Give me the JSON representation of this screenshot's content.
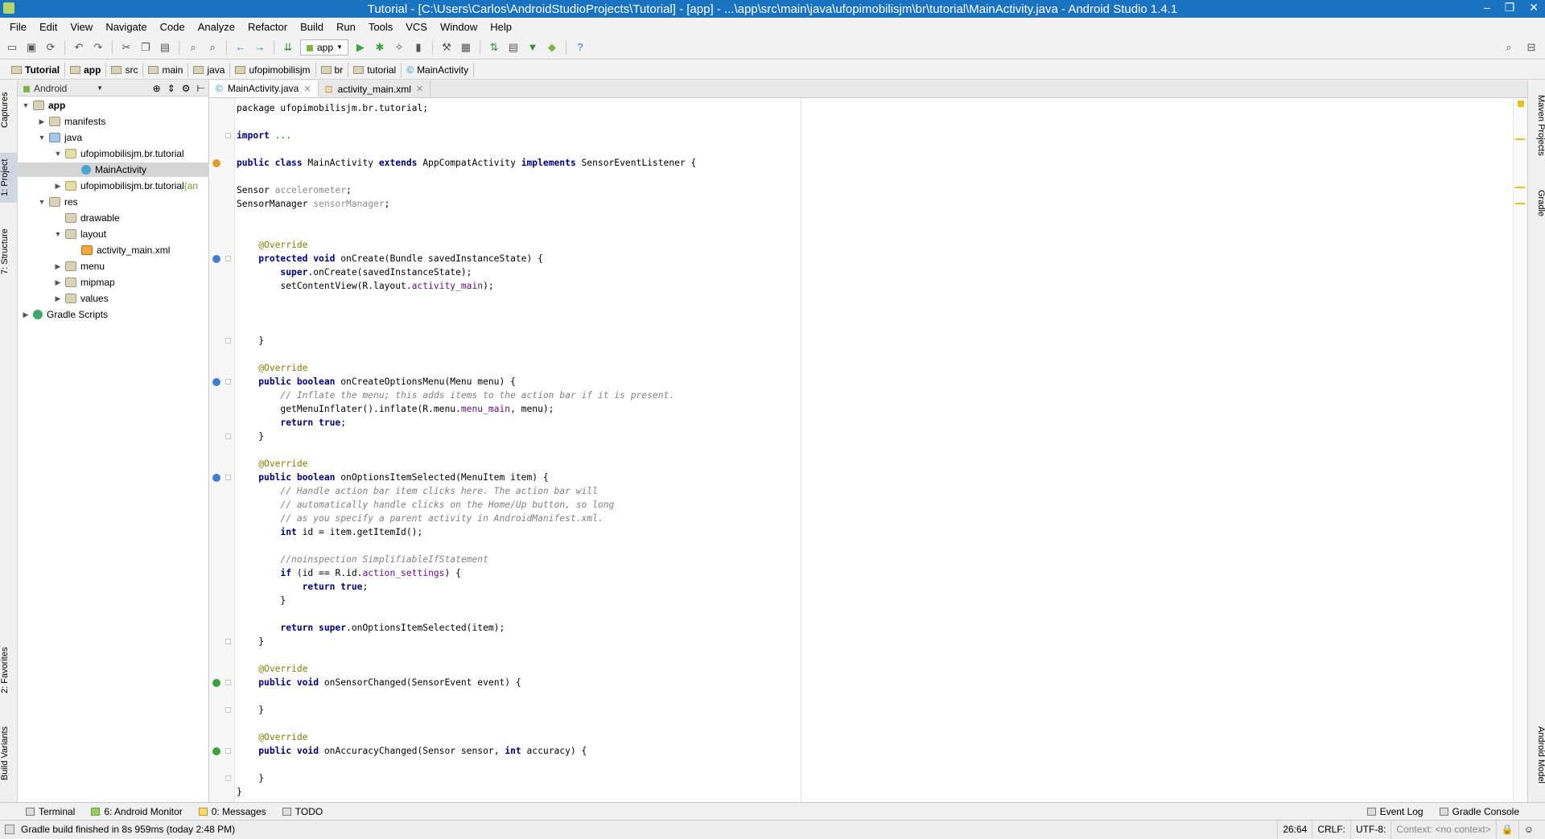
{
  "window": {
    "title": "Tutorial - [C:\\Users\\Carlos\\AndroidStudioProjects\\Tutorial] - [app] - ...\\app\\src\\main\\java\\ufopimobilisjm\\br\\tutorial\\MainActivity.java - Android Studio 1.4.1",
    "minimize": "–",
    "restore": "❐",
    "close": "✕"
  },
  "menu": [
    "File",
    "Edit",
    "View",
    "Navigate",
    "Code",
    "Analyze",
    "Refactor",
    "Build",
    "Run",
    "Tools",
    "VCS",
    "Window",
    "Help"
  ],
  "toolbar": {
    "run_config": "app"
  },
  "breadcrumb": [
    "Tutorial",
    "app",
    "src",
    "main",
    "java",
    "ufopimobilisjm",
    "br",
    "tutorial",
    "MainActivity"
  ],
  "left_tabs": [
    "Captures",
    "1: Project",
    "7: Structure",
    "2: Favorites",
    "Build Variants"
  ],
  "right_tabs": [
    "Maven Projects",
    "Gradle",
    "Android Model"
  ],
  "project": {
    "view_mode": "Android",
    "tree": [
      {
        "label": "app",
        "level": 0,
        "icon": "app",
        "expanded": true,
        "bold": true
      },
      {
        "label": "manifests",
        "level": 1,
        "icon": "folder",
        "expanded": false
      },
      {
        "label": "java",
        "level": 1,
        "icon": "jfolder",
        "expanded": true
      },
      {
        "label": "ufopimobilisjm.br.tutorial",
        "level": 2,
        "icon": "pkg",
        "expanded": true
      },
      {
        "label": "MainActivity",
        "level": 3,
        "icon": "cls",
        "selected": true
      },
      {
        "label": "ufopimobilisjm.br.tutorial",
        "suffix": " (an",
        "level": 2,
        "icon": "pkg",
        "expanded": false
      },
      {
        "label": "res",
        "level": 1,
        "icon": "folder",
        "expanded": true
      },
      {
        "label": "drawable",
        "level": 2,
        "icon": "folder"
      },
      {
        "label": "layout",
        "level": 2,
        "icon": "folder",
        "expanded": true
      },
      {
        "label": "activity_main.xml",
        "level": 3,
        "icon": "xml"
      },
      {
        "label": "menu",
        "level": 2,
        "icon": "folder",
        "expanded": false
      },
      {
        "label": "mipmap",
        "level": 2,
        "icon": "folder",
        "expanded": false
      },
      {
        "label": "values",
        "level": 2,
        "icon": "folder",
        "expanded": false
      },
      {
        "label": "Gradle Scripts",
        "level": 0,
        "icon": "grad",
        "expanded": false
      }
    ]
  },
  "editor_tabs": [
    {
      "label": "MainActivity.java",
      "active": true
    },
    {
      "label": "activity_main.xml",
      "active": false
    }
  ],
  "code": [
    [
      [
        "t",
        "package ufopimobilisjm.br.tutorial;"
      ]
    ],
    [],
    [
      [
        "kw",
        "import"
      ],
      [
        "t",
        " "
      ],
      [
        "lit",
        "..."
      ]
    ],
    [],
    [
      [
        "kw",
        "public class"
      ],
      [
        "t",
        " MainActivity "
      ],
      [
        "kw",
        "extends"
      ],
      [
        "t",
        " AppCompatActivity "
      ],
      [
        "kw",
        "implements"
      ],
      [
        "t",
        " SensorEventListener {"
      ]
    ],
    [],
    [
      [
        "t",
        "Sensor "
      ],
      [
        "fld",
        "accelerometer"
      ],
      [
        "t",
        ";"
      ]
    ],
    [
      [
        "t",
        "SensorManager "
      ],
      [
        "fld",
        "sensorManager"
      ],
      [
        "t",
        ";"
      ]
    ],
    [],
    [],
    [
      [
        "t",
        "    "
      ],
      [
        "ann",
        "@Override"
      ]
    ],
    [
      [
        "t",
        "    "
      ],
      [
        "kw",
        "protected void"
      ],
      [
        "t",
        " onCreate(Bundle savedInstanceState) {"
      ]
    ],
    [
      [
        "t",
        "        "
      ],
      [
        "kw",
        "super"
      ],
      [
        "t",
        ".onCreate(savedInstanceState);"
      ]
    ],
    [
      [
        "t",
        "        setContentView(R.layout."
      ],
      [
        "res",
        "activity_main"
      ],
      [
        "t",
        ");"
      ]
    ],
    [],
    [],
    [],
    [
      [
        "t",
        "    }"
      ]
    ],
    [],
    [
      [
        "t",
        "    "
      ],
      [
        "ann",
        "@Override"
      ]
    ],
    [
      [
        "t",
        "    "
      ],
      [
        "kw",
        "public boolean"
      ],
      [
        "t",
        " onCreateOptionsMenu(Menu menu) {"
      ]
    ],
    [
      [
        "t",
        "        "
      ],
      [
        "cm",
        "// Inflate the menu; this adds items to the action bar if it is present."
      ]
    ],
    [
      [
        "t",
        "        getMenuInflater().inflate(R.menu."
      ],
      [
        "res",
        "menu_main"
      ],
      [
        "t",
        ", menu);"
      ]
    ],
    [
      [
        "t",
        "        "
      ],
      [
        "kw",
        "return true"
      ],
      [
        "t",
        ";"
      ]
    ],
    [
      [
        "t",
        "    }"
      ]
    ],
    [],
    [
      [
        "t",
        "    "
      ],
      [
        "ann",
        "@Override"
      ]
    ],
    [
      [
        "t",
        "    "
      ],
      [
        "kw",
        "public boolean"
      ],
      [
        "t",
        " onOptionsItemSelected(MenuItem item) {"
      ]
    ],
    [
      [
        "t",
        "        "
      ],
      [
        "cm",
        "// Handle action bar item clicks here. The action bar will"
      ]
    ],
    [
      [
        "t",
        "        "
      ],
      [
        "cm",
        "// automatically handle clicks on the Home/Up button, so long"
      ]
    ],
    [
      [
        "t",
        "        "
      ],
      [
        "cm",
        "// as you specify a parent activity in AndroidManifest.xml."
      ]
    ],
    [
      [
        "t",
        "        "
      ],
      [
        "kw",
        "int"
      ],
      [
        "t",
        " id = item.getItemId();"
      ]
    ],
    [],
    [
      [
        "t",
        "        "
      ],
      [
        "cm",
        "//noinspection SimplifiableIfStatement"
      ]
    ],
    [
      [
        "t",
        "        "
      ],
      [
        "kw",
        "if"
      ],
      [
        "t",
        " (id == R.id."
      ],
      [
        "res",
        "action_settings"
      ],
      [
        "t",
        ") {"
      ]
    ],
    [
      [
        "t",
        "            "
      ],
      [
        "kw",
        "return true"
      ],
      [
        "t",
        ";"
      ]
    ],
    [
      [
        "t",
        "        }"
      ]
    ],
    [],
    [
      [
        "t",
        "        "
      ],
      [
        "kw",
        "return super"
      ],
      [
        "t",
        ".onOptionsItemSelected(item);"
      ]
    ],
    [
      [
        "t",
        "    }"
      ]
    ],
    [],
    [
      [
        "t",
        "    "
      ],
      [
        "ann",
        "@Override"
      ]
    ],
    [
      [
        "t",
        "    "
      ],
      [
        "kw",
        "public void"
      ],
      [
        "t",
        " onSensorChanged(SensorEvent event) {"
      ]
    ],
    [],
    [
      [
        "t",
        "    }"
      ]
    ],
    [],
    [
      [
        "t",
        "    "
      ],
      [
        "ann",
        "@Override"
      ]
    ],
    [
      [
        "t",
        "    "
      ],
      [
        "kw",
        "public void"
      ],
      [
        "t",
        " onAccuracyChanged(Sensor sensor, "
      ],
      [
        "kw",
        "int"
      ],
      [
        "t",
        " accuracy) {"
      ]
    ],
    [],
    [
      [
        "t",
        "    }"
      ]
    ],
    [
      [
        "t",
        "}"
      ]
    ]
  ],
  "gutter_markers": [
    {
      "line": 4,
      "kind": "class"
    },
    {
      "line": 11,
      "kind": "override"
    },
    {
      "line": 20,
      "kind": "override"
    },
    {
      "line": 27,
      "kind": "override"
    },
    {
      "line": 42,
      "kind": "implement"
    },
    {
      "line": 47,
      "kind": "implement"
    }
  ],
  "bottom_tools": [
    {
      "label": "Terminal",
      "icon": "terminal-icon"
    },
    {
      "label": "6: Android Monitor",
      "icon": "android-icon"
    },
    {
      "label": "0: Messages",
      "icon": "messages-icon"
    },
    {
      "label": "TODO",
      "icon": "todo-icon"
    }
  ],
  "bottom_right_tools": [
    {
      "label": "Event Log",
      "icon": "event-log-icon"
    },
    {
      "label": "Gradle Console",
      "icon": "gradle-console-icon"
    }
  ],
  "status": {
    "message": "Gradle build finished in 8s 959ms (today 2:48 PM)",
    "position": "26:64",
    "line_separator": "CRLF:",
    "encoding": "UTF-8:",
    "context": "Context: <no context>"
  }
}
